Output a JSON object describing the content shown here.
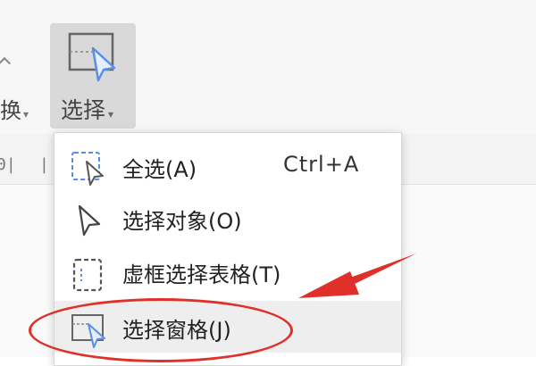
{
  "toolbar": {
    "prev_button_label": "换",
    "select_button_label": "选择"
  },
  "ruler": {
    "marks": [
      "0|",
      "|"
    ]
  },
  "menu": {
    "items": [
      {
        "label": "全选(A)",
        "shortcut": "Ctrl+A",
        "icon": "select-all-icon"
      },
      {
        "label": "选择对象(O)",
        "shortcut": "",
        "icon": "cursor-arrow-icon"
      },
      {
        "label": "虚框选择表格(T)",
        "shortcut": "",
        "icon": "dashed-frame-icon"
      },
      {
        "label": "选择窗格(J)",
        "shortcut": "",
        "icon": "selection-pane-icon",
        "highlighted": true
      }
    ]
  },
  "annotation": {
    "oval_color": "#e0302a",
    "arrow_color": "#e0302a"
  },
  "colors": {
    "accent_icon_blue": "#5b8ee6",
    "highlight_bg": "#eeeeee",
    "button_active_bg": "#d9d9d9"
  }
}
